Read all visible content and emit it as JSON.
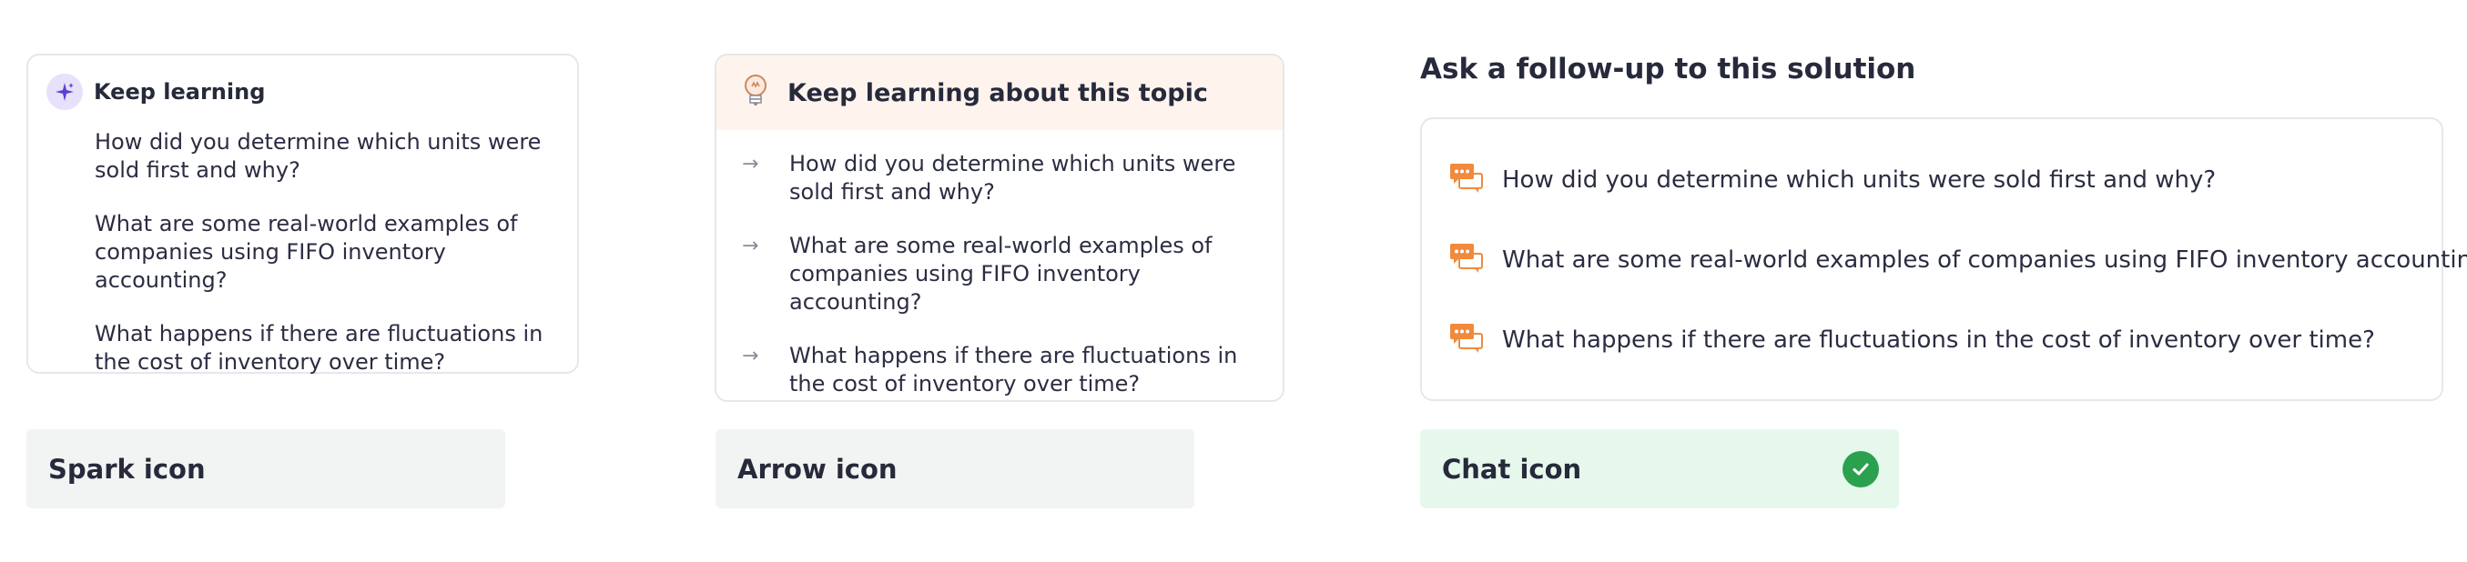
{
  "colors": {
    "spark_accent": "#5b3fd1",
    "spark_badge_bg": "#e7e1fb",
    "arrow_header_bg": "#fff3ee",
    "chat_icon": "#f08a3c",
    "chat_caption_bg": "#e6f8ec",
    "check_green": "#2aa14f",
    "caption_bg": "#f2f4f3",
    "border": "#e6e7ea",
    "text": "#2b2d42"
  },
  "spark_card": {
    "icon": "spark-icon",
    "title": "Keep learning",
    "questions": [
      "How did you determine which units were sold first and why?",
      "What are some real-world examples of companies using FIFO inventory accounting?",
      "What happens if there are fluctuations in the cost of inventory over time?"
    ]
  },
  "arrow_card": {
    "icon": "lightbulb-icon",
    "item_icon": "arrow-right-icon",
    "arrow_glyph": "→",
    "title": "Keep learning about this topic",
    "questions": [
      "How did you determine which units were sold first and why?",
      "What are some real-world examples of companies using FIFO inventory accounting?",
      "What happens if there are fluctuations in the cost of inventory over time?"
    ]
  },
  "chat_card": {
    "heading": "Ask a follow-up to this solution",
    "item_icon": "chat-bubbles-icon",
    "questions": [
      "How did you determine which units were sold first and why?",
      "What are some real-world examples of companies using FIFO inventory accounting?",
      "What happens if there are fluctuations in the cost of inventory over time?"
    ]
  },
  "captions": {
    "spark": "Spark icon",
    "arrow": "Arrow icon",
    "chat": "Chat icon",
    "chat_selected_icon": "check-circle-icon"
  }
}
